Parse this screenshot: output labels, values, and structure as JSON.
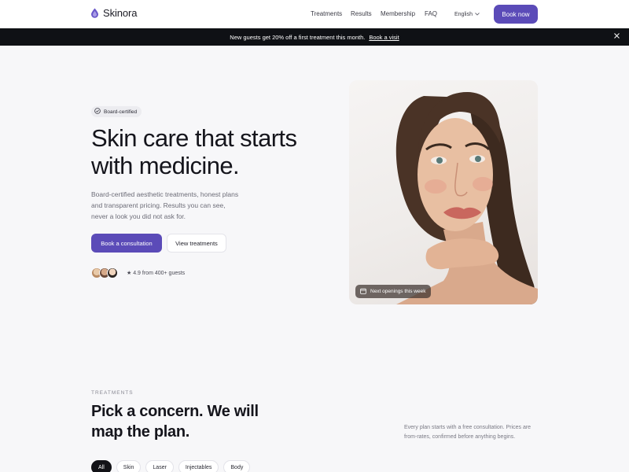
{
  "brand": {
    "name": "Skinora",
    "logo_icon": "drop-icon",
    "accent": "#5b4bb8"
  },
  "nav": {
    "links": [
      "Treatments",
      "Results",
      "Membership",
      "FAQ"
    ],
    "language": "English",
    "cta": "Book now"
  },
  "announcement": {
    "text": "New guests get 20% off a first treatment this month.",
    "link": "Book a visit",
    "close_icon": "close-icon"
  },
  "hero": {
    "badge": "Board-certified",
    "title": "Skin care that starts with medicine.",
    "subtitle": "Board-certified aesthetic treatments, honest plans and transparent pricing. Results you can see, never a look you did not ask for.",
    "primary_cta": "Book a consultation",
    "secondary_cta": "View treatments",
    "rating": "★ 4.9 from 400+ guests",
    "image_chip": "Next openings this week"
  },
  "treatments": {
    "eyebrow": "TREATMENTS",
    "title": "Pick a concern. We will map the plan.",
    "description": "Every plan starts with a free consultation. Prices are from-rates, confirmed before anything begins.",
    "filters": [
      "All",
      "Skin",
      "Laser",
      "Injectables",
      "Body"
    ],
    "active_filter": "All"
  }
}
